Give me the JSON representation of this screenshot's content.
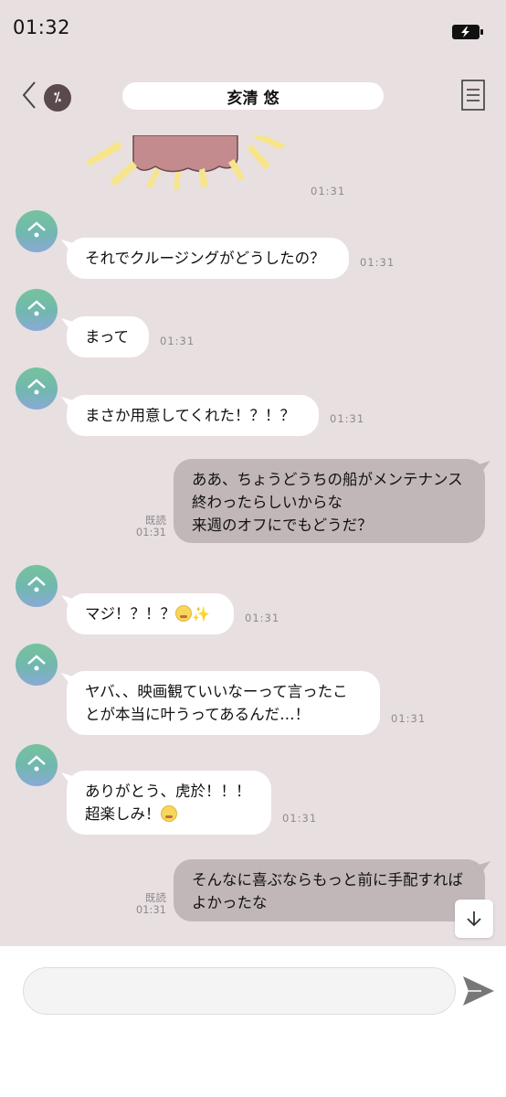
{
  "status": {
    "time": "01:32"
  },
  "header": {
    "title": "亥清 悠",
    "partner_initial": "⁒"
  },
  "messages": [
    {
      "type": "sticker",
      "time": "01:31"
    },
    {
      "type": "in",
      "text": "それでクルージングがどうしたの？",
      "time": "01:31"
    },
    {
      "type": "in",
      "text": "まって",
      "time": "01:31"
    },
    {
      "type": "in",
      "text": "まさか用意してくれた！？！？",
      "time": "01:31"
    },
    {
      "type": "out",
      "lines": [
        "ああ、ちょうどうちの船がメンテナンス",
        "終わったらしいからな",
        "来週のオフにでもどうだ？"
      ],
      "read": "既読",
      "time": "01:31"
    },
    {
      "type": "in",
      "text": "マジ！？！？",
      "emoji": "pleading-face",
      "sparkle": "✨",
      "time": "01:31"
    },
    {
      "type": "in",
      "lines": [
        "ヤバ、、映画観ていいなーって言ったこ",
        "とが本当に叶うってあるんだ…！"
      ],
      "time": "01:31"
    },
    {
      "type": "in",
      "lines": [
        "ありがとう、虎於！！！",
        "超楽しみ！"
      ],
      "emoji": "grinning-squinting-face",
      "time": "01:31"
    },
    {
      "type": "out",
      "lines": [
        "そんなに喜ぶならもっと前に手配すれば",
        "よかったな"
      ],
      "read": "既読",
      "time": "01:31"
    }
  ],
  "composer": {
    "placeholder": ""
  },
  "icons": {
    "back": "chevron-left-icon",
    "menu": "menu-icon",
    "battery": "battery-charging-icon",
    "scroll": "arrow-down-icon",
    "send": "send-icon"
  },
  "colors": {
    "background": "#e8dfe1",
    "incoming_bubble": "#ffffff",
    "outgoing_bubble": "#c1b7b9",
    "avatar_top": "#74c39c",
    "avatar_bottom": "#8aa9d7"
  }
}
